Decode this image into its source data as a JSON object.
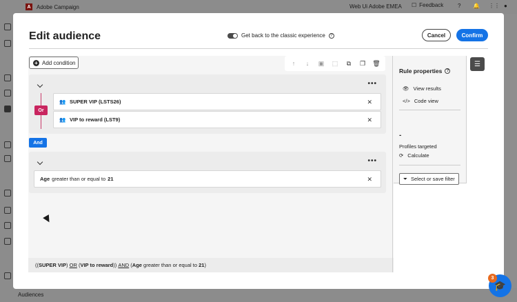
{
  "shell": {
    "app_name": "Adobe Campaign",
    "org_name": "Web Ui Adobe EMEA",
    "feedback_label": "Feedback",
    "bottom_label": "Audiences"
  },
  "modal": {
    "title": "Edit audience",
    "classic_toggle_label": "Get back to the classic experience",
    "cancel_label": "Cancel",
    "confirm_label": "Confirm",
    "add_condition_label": "Add condition"
  },
  "groups": [
    {
      "operator": "Or",
      "conditions": [
        {
          "label": "SUPER VIP (LSTS26)"
        },
        {
          "label": "VIP to reward (LST9)"
        }
      ]
    },
    {
      "conditions": [
        {
          "field": "Age",
          "operator": "greater than or equal to",
          "value": "21"
        }
      ]
    }
  ],
  "between_groups_operator": "And",
  "summary": {
    "p1": "((",
    "s1": "SUPER VIP",
    "p2": ") ",
    "op_or": "OR",
    "p3": " (",
    "s2": "VIP to reward",
    "p4": ")) ",
    "op_and": "AND",
    "p5": " (",
    "field": "Age",
    "op": " greater than or equal to ",
    "value": "21",
    "p6": ")"
  },
  "rule_properties": {
    "title": "Rule properties",
    "view_results": "View results",
    "code_view": "Code view",
    "profiles_count": "-",
    "profiles_targeted": "Profiles targeted",
    "calculate": "Calculate",
    "select_save_filter": "Select or save filter"
  },
  "help_badge_count": "3",
  "colors": {
    "accent": "#1473e6",
    "or_badge": "#c9255f"
  }
}
